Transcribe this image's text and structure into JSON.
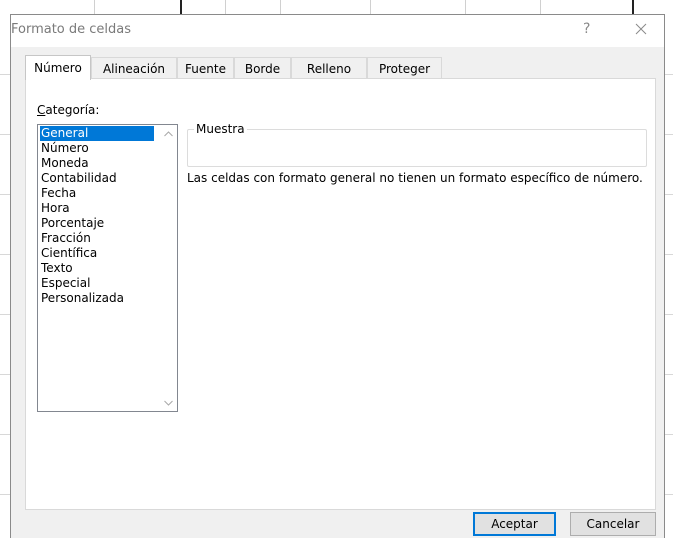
{
  "dialog": {
    "title": "Formato de celdas",
    "help_label": "?"
  },
  "tabs": [
    {
      "label": "Número",
      "active": true
    },
    {
      "label": "Alineación",
      "active": false
    },
    {
      "label": "Fuente",
      "active": false
    },
    {
      "label": "Borde",
      "active": false
    },
    {
      "label": "Relleno",
      "active": false
    },
    {
      "label": "Proteger",
      "active": false
    }
  ],
  "category": {
    "label_accel": "C",
    "label_rest": "ategoría:",
    "items": [
      "General",
      "Número",
      "Moneda",
      "Contabilidad",
      "Fecha",
      "Hora",
      "Porcentaje",
      "Fracción",
      "Científica",
      "Texto",
      "Especial",
      "Personalizada"
    ],
    "selected_index": 0
  },
  "sample": {
    "legend": "Muestra",
    "value": ""
  },
  "description": "Las celdas con formato general no tienen un formato específico de número.",
  "buttons": {
    "ok": "Aceptar",
    "cancel": "Cancelar"
  },
  "colors": {
    "selection": "#0078d7",
    "dialog_bg": "#f0f0f0"
  }
}
